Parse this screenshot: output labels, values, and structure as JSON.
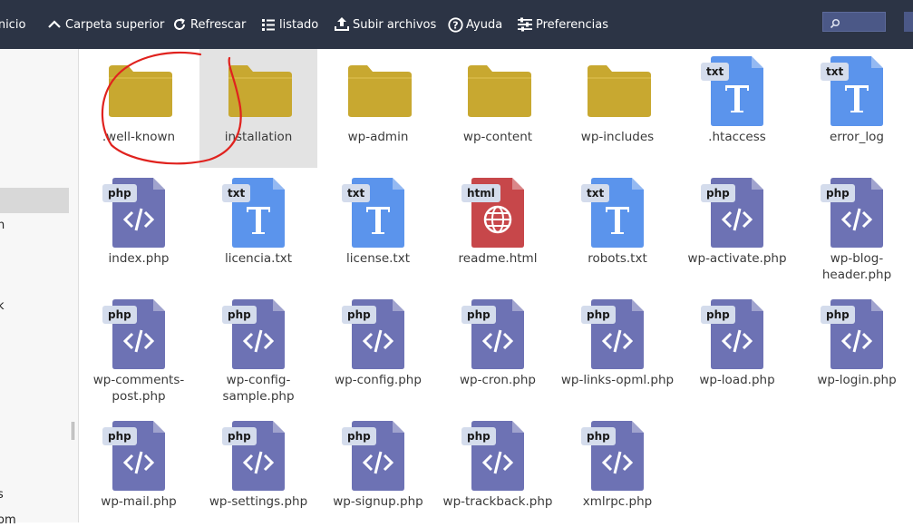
{
  "toolbar": {
    "items": [
      {
        "label": "Inicio",
        "icon": "home-icon"
      },
      {
        "label": "Carpeta superior",
        "icon": "chevron-up-icon"
      },
      {
        "label": "Refrescar",
        "icon": "refresh-icon"
      },
      {
        "label": "listado",
        "icon": "list-icon"
      },
      {
        "label": "Subir archivos",
        "icon": "upload-icon"
      },
      {
        "label": "Ayuda",
        "icon": "help-icon"
      },
      {
        "label": "Preferencias",
        "icon": "settings-sliders-icon"
      }
    ],
    "search_placeholder": ""
  },
  "sidebar": {
    "fragments": [
      "n",
      "k",
      "s",
      "om"
    ]
  },
  "colors": {
    "toolbar_bg": "#2c3445",
    "folder": "#c8a830",
    "txt_file": "#5b94ec",
    "php_file": "#6d72b4",
    "html_file": "#c7474a",
    "annotation": "#e0221e"
  },
  "files": [
    {
      "name": ".well-known",
      "type": "folder"
    },
    {
      "name": "installation",
      "type": "folder",
      "selected": true
    },
    {
      "name": "wp-admin",
      "type": "folder"
    },
    {
      "name": "wp-content",
      "type": "folder"
    },
    {
      "name": "wp-includes",
      "type": "folder"
    },
    {
      "name": ".htaccess",
      "type": "txt",
      "tag": "txt"
    },
    {
      "name": "error_log",
      "type": "txt",
      "tag": "txt"
    },
    {
      "name": "index.php",
      "type": "php",
      "tag": "php"
    },
    {
      "name": "licencia.txt",
      "type": "txt",
      "tag": "txt"
    },
    {
      "name": "license.txt",
      "type": "txt",
      "tag": "txt"
    },
    {
      "name": "readme.html",
      "type": "html",
      "tag": "html"
    },
    {
      "name": "robots.txt",
      "type": "txt",
      "tag": "txt"
    },
    {
      "name": "wp-activate.php",
      "type": "php",
      "tag": "php"
    },
    {
      "name": "wp-blog-header.php",
      "type": "php",
      "tag": "php"
    },
    {
      "name": "wp-comments-post.php",
      "type": "php",
      "tag": "php"
    },
    {
      "name": "wp-config-sample.php",
      "type": "php",
      "tag": "php"
    },
    {
      "name": "wp-config.php",
      "type": "php",
      "tag": "php"
    },
    {
      "name": "wp-cron.php",
      "type": "php",
      "tag": "php"
    },
    {
      "name": "wp-links-opml.php",
      "type": "php",
      "tag": "php"
    },
    {
      "name": "wp-load.php",
      "type": "php",
      "tag": "php"
    },
    {
      "name": "wp-login.php",
      "type": "php",
      "tag": "php"
    },
    {
      "name": "wp-mail.php",
      "type": "php",
      "tag": "php"
    },
    {
      "name": "wp-settings.php",
      "type": "php",
      "tag": "php"
    },
    {
      "name": "wp-signup.php",
      "type": "php",
      "tag": "php"
    },
    {
      "name": "wp-trackback.php",
      "type": "php",
      "tag": "php"
    },
    {
      "name": "xmlrpc.php",
      "type": "php",
      "tag": "php"
    }
  ]
}
